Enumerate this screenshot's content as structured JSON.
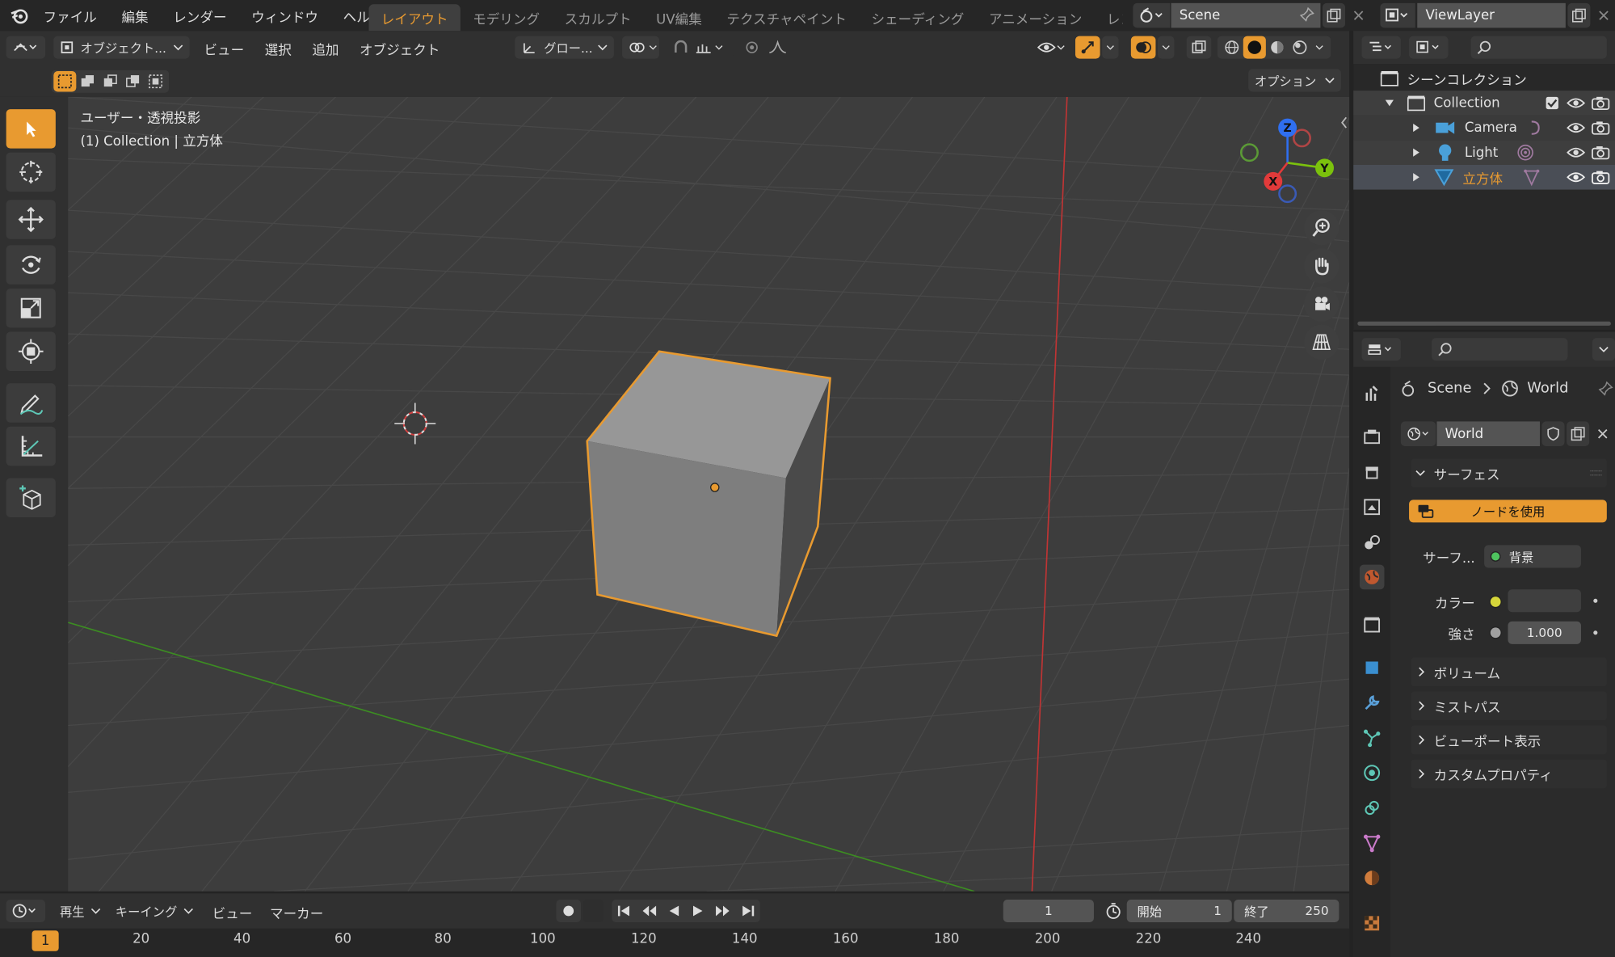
{
  "topbar": {
    "menus": [
      "ファイル",
      "編集",
      "レンダー",
      "ウィンドウ",
      "ヘルプ"
    ],
    "workspaces": [
      {
        "label": "レイアウト",
        "active": true
      },
      {
        "label": "モデリング",
        "active": false
      },
      {
        "label": "スカルプト",
        "active": false
      },
      {
        "label": "UV編集",
        "active": false
      },
      {
        "label": "テクスチャペイント",
        "active": false
      },
      {
        "label": "シェーディング",
        "active": false
      },
      {
        "label": "アニメーション",
        "active": false
      },
      {
        "label": "レンダリ",
        "active": false
      }
    ],
    "scene_name": "Scene",
    "view_layer": "ViewLayer"
  },
  "viewport_header": {
    "mode": "オブジェクト...",
    "menus": [
      "ビュー",
      "選択",
      "追加",
      "オブジェクト"
    ],
    "transform_orientation": "グロー...",
    "options_label": "オプション"
  },
  "viewport": {
    "view_name": "ユーザー・透視投影",
    "context_line": "(1) Collection | 立方体",
    "gizmo_axes": {
      "x": "X",
      "y": "Y",
      "z": "Z"
    }
  },
  "outliner": {
    "title": "シーンコレクション",
    "rows": [
      {
        "label": "Collection",
        "kind": "collection"
      },
      {
        "label": "Camera",
        "kind": "camera"
      },
      {
        "label": "Light",
        "kind": "light"
      },
      {
        "label": "立方体",
        "kind": "mesh",
        "selected": true
      }
    ]
  },
  "properties": {
    "breadcrumb_scene": "Scene",
    "breadcrumb_world": "World",
    "world_name": "World",
    "surface_panel": "サーフェス",
    "use_nodes_label": "ノードを使用",
    "surface_label": "サーフ...",
    "surface_value": "背景",
    "color_label": "カラー",
    "strength_label": "強さ",
    "strength_value": "1.000",
    "panels": [
      "ボリューム",
      "ミストパス",
      "ビューポート表示",
      "カスタムプロパティ"
    ]
  },
  "timeline": {
    "playback_label": "再生",
    "keying_label": "キーイング",
    "view_label": "ビュー",
    "marker_label": "マーカー",
    "current_frame": "1",
    "start_label": "開始",
    "start_value": "1",
    "end_label": "終了",
    "end_value": "250",
    "ruler_current": "1",
    "ruler": [
      "20",
      "40",
      "60",
      "80",
      "100",
      "120",
      "140",
      "160",
      "180",
      "200",
      "220",
      "240"
    ]
  },
  "colors": {
    "accent": "#e89a30",
    "viewport_bg": "#3d3d3d",
    "x_axis": "#e23a3a",
    "y_axis": "#7bc10d",
    "z_axis": "#2f6ff0"
  }
}
